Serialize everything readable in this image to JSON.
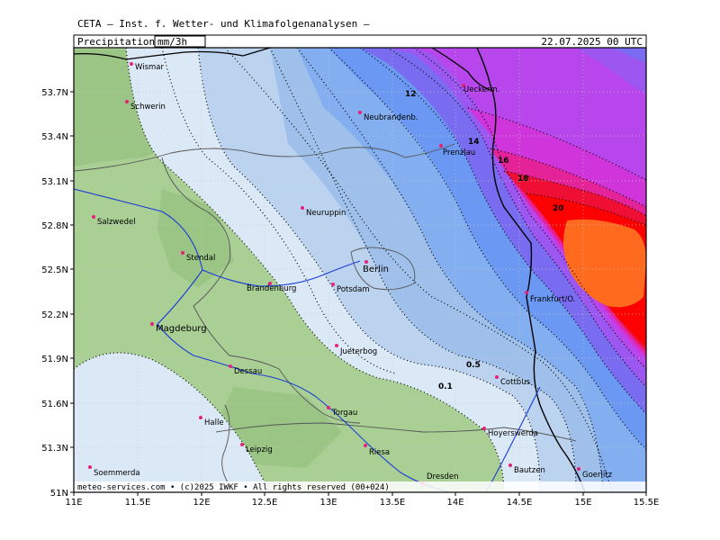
{
  "header": {
    "source": "CETA — Inst. f. Wetter- und Klimafolgenanalysen —",
    "field": "Precipitation",
    "units": "mm/3h",
    "valid_time": "22.07.2025 00 UTC"
  },
  "footer": {
    "credit": "meteo-services.com  •  (c)2025 IWKF  •  All rights reserved (00+024)"
  },
  "axes": {
    "x_ticks": [
      "11E",
      "11.5E",
      "12E",
      "12.5E",
      "13E",
      "13.5E",
      "14E",
      "14.5E",
      "15E",
      "15.5E"
    ],
    "y_ticks": [
      "53.7N",
      "53.4N",
      "53.1N",
      "52.8N",
      "52.5N",
      "52.2N",
      "51.9N",
      "51.6N",
      "51.3N",
      "51N"
    ]
  },
  "colors": {
    "dry_green": "#a9cf94",
    "dry_green_dark": "#9ac585",
    "p01": "#dbe8f6",
    "p05": "#bcd3ef",
    "p2": "#9ec0ea",
    "p4": "#83aff0",
    "p6": "#6a98f2",
    "p8": "#7a6cf0",
    "p10": "#9b57f0",
    "p12": "#b746ec",
    "p14": "#cf35db",
    "p16": "#e42399",
    "p18": "#ef0f35",
    "p20": "#ff0000",
    "p22": "#ff6a1e",
    "river": "#1a3cd6",
    "city_marker": "#e8207a"
  },
  "contour_labels": [
    "0.1",
    "0.5",
    "12",
    "14",
    "16",
    "18",
    "20"
  ],
  "cities": [
    {
      "name": "Wismar"
    },
    {
      "name": "Schwerin"
    },
    {
      "name": "Neubrandenb."
    },
    {
      "name": "Ueckerm."
    },
    {
      "name": "Prenzlau"
    },
    {
      "name": "Salzwedel"
    },
    {
      "name": "Neuruppin"
    },
    {
      "name": "Stendal"
    },
    {
      "name": "Berlin"
    },
    {
      "name": "Brandenburg"
    },
    {
      "name": "Potsdam"
    },
    {
      "name": "Frankfurt/O."
    },
    {
      "name": "Magdeburg"
    },
    {
      "name": "Dessau"
    },
    {
      "name": "Jueterbog"
    },
    {
      "name": "Cottbus"
    },
    {
      "name": "Halle"
    },
    {
      "name": "Torgau"
    },
    {
      "name": "Hoyerswerda"
    },
    {
      "name": "Leipzig"
    },
    {
      "name": "Riesa"
    },
    {
      "name": "Bautzen"
    },
    {
      "name": "Goerlitz"
    },
    {
      "name": "Soemmerda"
    },
    {
      "name": "Dresden"
    }
  ]
}
